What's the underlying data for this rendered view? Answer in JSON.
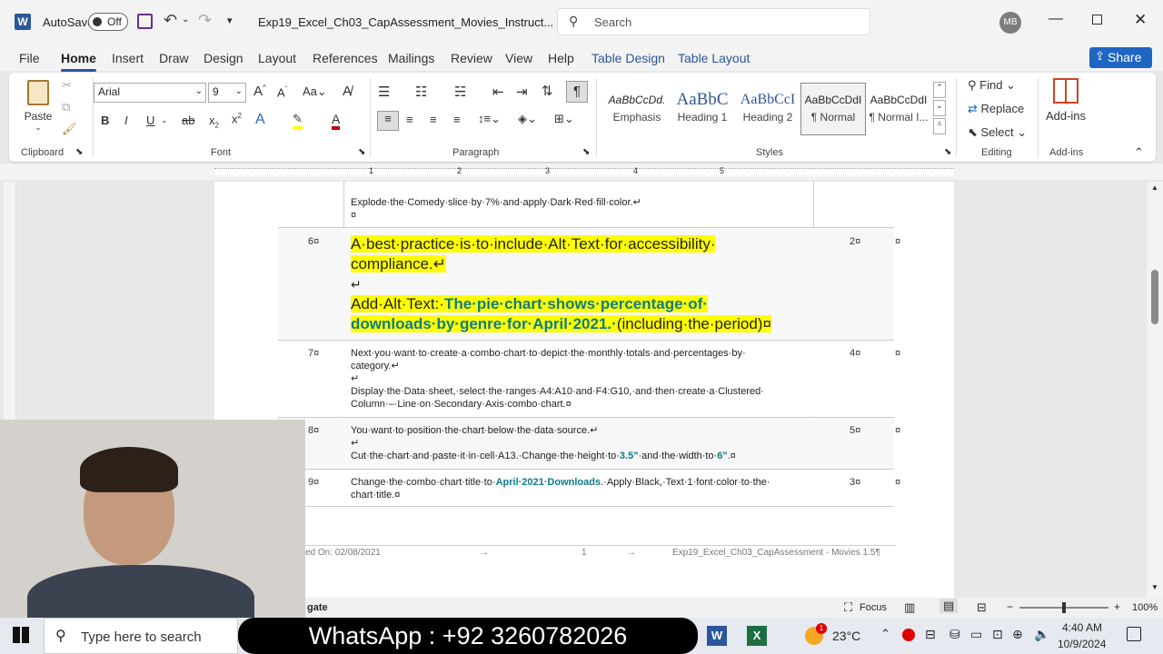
{
  "titlebar": {
    "autosave": "AutoSave",
    "toggle": "Off",
    "doc_title": "Exp19_Excel_Ch03_CapAssessment_Movies_Instruct...",
    "search_placeholder": "Search",
    "avatar": "MB"
  },
  "tabs": [
    "File",
    "Home",
    "Insert",
    "Draw",
    "Design",
    "Layout",
    "References",
    "Mailings",
    "Review",
    "View",
    "Help",
    "Table Design",
    "Table Layout"
  ],
  "share": "Share",
  "ribbon": {
    "clipboard": {
      "paste": "Paste",
      "label": "Clipboard"
    },
    "font": {
      "name": "Arial",
      "size": "9",
      "label": "Font"
    },
    "paragraph": {
      "label": "Paragraph"
    },
    "styles": {
      "label": "Styles",
      "items": [
        {
          "preview": "AaBbCcDd.",
          "name": "Emphasis"
        },
        {
          "preview": "AaBbC",
          "name": "Heading 1"
        },
        {
          "preview": "AaBbCcI",
          "name": "Heading 2"
        },
        {
          "preview": "AaBbCcDdI",
          "name": "¶ Normal"
        },
        {
          "preview": "AaBbCcDdI",
          "name": "¶ Normal I..."
        }
      ]
    },
    "editing": {
      "find": "Find",
      "replace": "Replace",
      "select": "Select",
      "label": "Editing"
    },
    "addins": {
      "button": "Add-ins",
      "label": "Add-ins"
    }
  },
  "ruler": [
    "1",
    "2",
    "3",
    "4",
    "5"
  ],
  "doc": {
    "r0_text": "Explode·the·Comedy·slice·by·7%·and·apply·Dark·Red·fill·color.↵",
    "r0_mark": "¤",
    "rows": [
      {
        "num": "6¤",
        "points": "2¤",
        "end": "¤",
        "line1": "A·best·practice·is·to·include·Alt·Text·for·accessibility·",
        "line2": "compliance.↵",
        "line3": "↵",
        "line4a": "Add·Alt·Text:·",
        "line4b": "The·pie·chart·shows·percentage·of·",
        "line5b": "downloads·by·genre·for·April·2021.·",
        "line5c": "(including·the·period)¤"
      },
      {
        "num": "7¤",
        "points": "4¤",
        "end": "¤",
        "line1": "Next·you·want·to·create·a·combo·chart·to·depict·the·monthly·totals·and·percentages·by·",
        "line2": "category.↵",
        "line3": "↵",
        "line4": "Display·the·Data·sheet,·select·the·ranges·A4:A10·and·F4:G10,·and·then·create·a·Clustered·",
        "line5": "Column·–·Line·on·Secondary·Axis·combo·chart.¤"
      },
      {
        "num": "8¤",
        "points": "5¤",
        "end": "¤",
        "line1": "You·want·to·position·the·chart·below·the·data·source.↵",
        "line2": "↵",
        "line3a": "Cut·the·chart·and·paste·it·in·cell·A13.·Change·the·height·to·",
        "line3b": "3.5\"",
        "line3c": "·and·the·width·to·",
        "line3d": "6\"",
        "line3e": ".¤"
      },
      {
        "num": "9¤",
        "points": "3¤",
        "end": "¤",
        "line1a": "Change·the·combo·chart·title·to·",
        "line1b": "April·2021·Downloads",
        "line1c": ".·Apply·Black,·Text·1·font·color·to·the·",
        "line2": "chart·title.¤"
      }
    ],
    "footer": {
      "left": "ed On: 02/08/2021",
      "arrow1": "→",
      "page": "1",
      "arrow2": "→",
      "right": "Exp19_Excel_Ch03_CapAssessment - Movies 1.5¶"
    }
  },
  "statusbar": {
    "left": "gate",
    "focus": "Focus",
    "zoom": "100%"
  },
  "taskbar": {
    "search_placeholder": "Type here to search",
    "overlay": "WhatsApp : +92 3260782026",
    "temp": "23°C",
    "time": "4:40 AM",
    "date": "10/9/2024",
    "weather_badge": "1"
  },
  "colors": {
    "accent": "#2b579a",
    "highlight": "#ffff00",
    "teal": "#0e7a8a"
  }
}
